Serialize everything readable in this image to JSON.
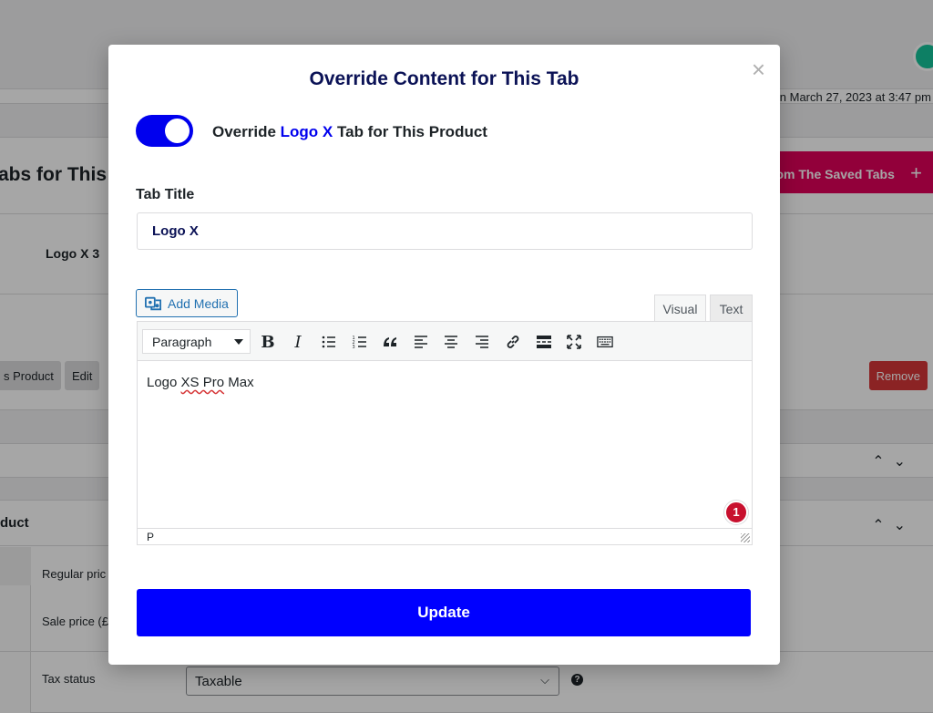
{
  "background": {
    "date_text": "n March 27, 2023 at 3:47 pm",
    "heading": "abs for This",
    "saved_tabs_button": "rom The Saved Tabs",
    "plus_icon": "+",
    "row_item": "Logo X 3",
    "product_button": "s Product",
    "edit_button": "Edit",
    "remove_button": "Remove",
    "product_section_title": "duct",
    "regular_price_label": "Regular pric",
    "sale_price_label": "Sale price (£",
    "tax_status_label": "Tax status",
    "tax_status_value": "Taxable",
    "help_icon": "?"
  },
  "modal": {
    "title": "Override Content for This Tab",
    "close_icon": "×",
    "toggle": {
      "on": true,
      "label_prefix": "Override ",
      "label_accent": "Logo X",
      "label_suffix": " Tab for This Product"
    },
    "tab_title": {
      "label": "Tab Title",
      "value": "Logo X"
    },
    "editor": {
      "add_media_label": "Add Media",
      "tab_visual": "Visual",
      "tab_text": "Text",
      "format_select": "Paragraph",
      "bold": "B",
      "italic": "I",
      "content_before": "Logo ",
      "content_misspelled": "XS Pro",
      "content_after": " Max",
      "notification_count": "1",
      "status_path": "P"
    },
    "update_button": "Update"
  },
  "colors": {
    "accent": "#0000ee",
    "title": "#0b1256",
    "pink": "#e0005a",
    "remove": "#d63638"
  }
}
